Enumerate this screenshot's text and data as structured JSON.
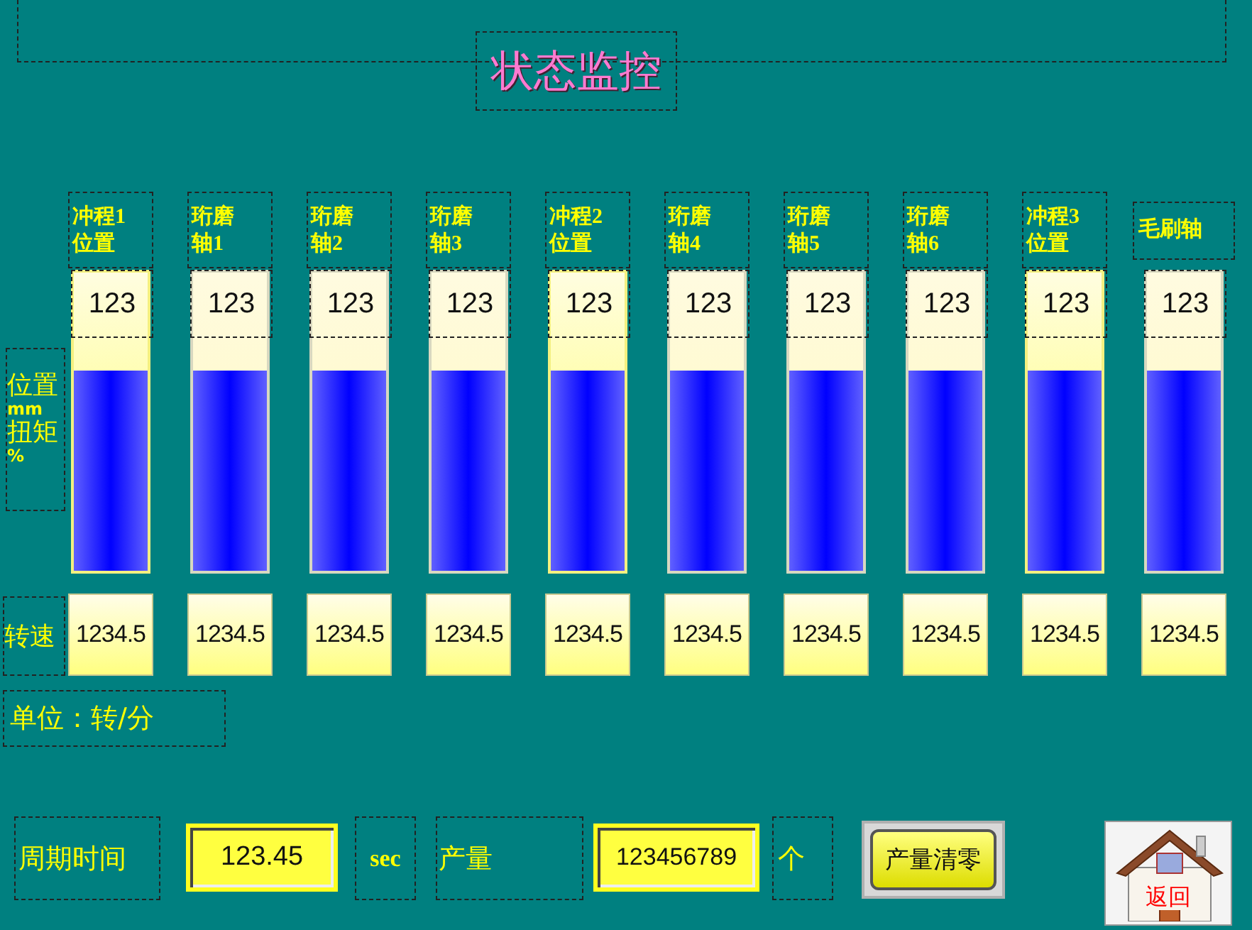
{
  "title": "状态监控",
  "position_label": [
    "位置",
    "mm",
    "扭矩",
    "%"
  ],
  "speed_label": "转速",
  "columns": [
    {
      "label": [
        "冲程1",
        "位置"
      ],
      "kind": "stroke",
      "reading": "123",
      "level": 0.67,
      "speed": "1234.5"
    },
    {
      "label": [
        "珩磨",
        "轴1"
      ],
      "kind": "axis",
      "reading": "123",
      "level": 0.67,
      "speed": "1234.5"
    },
    {
      "label": [
        "珩磨",
        "轴2"
      ],
      "kind": "axis",
      "reading": "123",
      "level": 0.67,
      "speed": "1234.5"
    },
    {
      "label": [
        "珩磨",
        "轴3"
      ],
      "kind": "axis",
      "reading": "123",
      "level": 0.67,
      "speed": "1234.5"
    },
    {
      "label": [
        "冲程2",
        "位置"
      ],
      "kind": "stroke",
      "reading": "123",
      "level": 0.67,
      "speed": "1234.5"
    },
    {
      "label": [
        "珩磨",
        "轴4"
      ],
      "kind": "axis",
      "reading": "123",
      "level": 0.67,
      "speed": "1234.5"
    },
    {
      "label": [
        "珩磨",
        "轴5"
      ],
      "kind": "axis",
      "reading": "123",
      "level": 0.67,
      "speed": "1234.5"
    },
    {
      "label": [
        "珩磨",
        "轴6"
      ],
      "kind": "axis",
      "reading": "123",
      "level": 0.67,
      "speed": "1234.5"
    },
    {
      "label": [
        "冲程3",
        "位置"
      ],
      "kind": "stroke",
      "reading": "123",
      "level": 0.67,
      "speed": "1234.5"
    },
    {
      "label": [
        "毛刷轴"
      ],
      "kind": "axis",
      "reading": "123",
      "level": 0.67,
      "speed": "1234.5"
    }
  ],
  "unit_note": "单位：转/分",
  "cycle": {
    "label": "周期时间",
    "value": "123.45",
    "unit": "sec"
  },
  "output": {
    "label": "产量",
    "value": "123456789",
    "unit": "个"
  },
  "reset_button": "产量清零",
  "exit_button": "返回"
}
